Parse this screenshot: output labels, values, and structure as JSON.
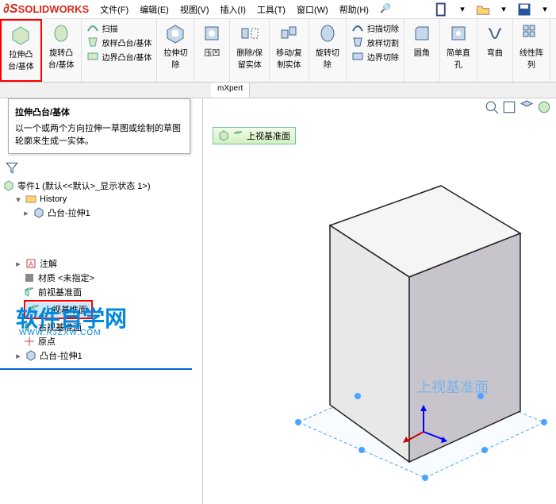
{
  "app": {
    "name": "SOLIDWORKS"
  },
  "menu": {
    "file": "文件(F)",
    "edit": "编辑(E)",
    "view": "视图(V)",
    "insert": "插入(I)",
    "tools": "工具(T)",
    "window": "窗口(W)",
    "help": "帮助(H)"
  },
  "ribbon": {
    "extrude": "拉伸凸\n台/基体",
    "revolve": "旋转凸\n台/基体",
    "sweep": "扫描",
    "loft": "放样凸台/基体",
    "boundary": "边界凸台/基体",
    "extrudeCut": "拉伸切\n除",
    "hole": "压凹",
    "deleteKeep": "删除/保\n留实体",
    "moveCopy": "移动/复\n制实体",
    "revolveCut": "旋转切\n除",
    "sweepCut": "扫描切除",
    "loftCut": "放样切割",
    "boundaryCut": "边界切除",
    "fillet": "圆角",
    "chamfer": "简单直\n孔",
    "wrap": "弯曲",
    "linearPattern": "线性阵\n列"
  },
  "tabs": {
    "dimxpert": "mXpert"
  },
  "tooltip": {
    "title": "拉伸凸台/基体",
    "body": "以一个或两个方向拉伸一草图或绘制的草图轮廓来生成一实体。"
  },
  "tree": {
    "root": "零件1 (默认<<默认>_显示状态 1>)",
    "history": "History",
    "extrude1": "凸台-拉伸1",
    "annotations": "注解",
    "material": "材质 <未指定>",
    "frontPlane": "前视基准面",
    "topPlane": "上视基准面",
    "rightPlane": "右视基准面",
    "origin": "原点",
    "extrude1b": "凸台-拉伸1"
  },
  "viewport": {
    "planeTag": "上视基准面",
    "planeLabel": "上视基准面"
  },
  "watermark": {
    "main": "软件自学网",
    "sub": "WWW.RJZXW.COM"
  }
}
